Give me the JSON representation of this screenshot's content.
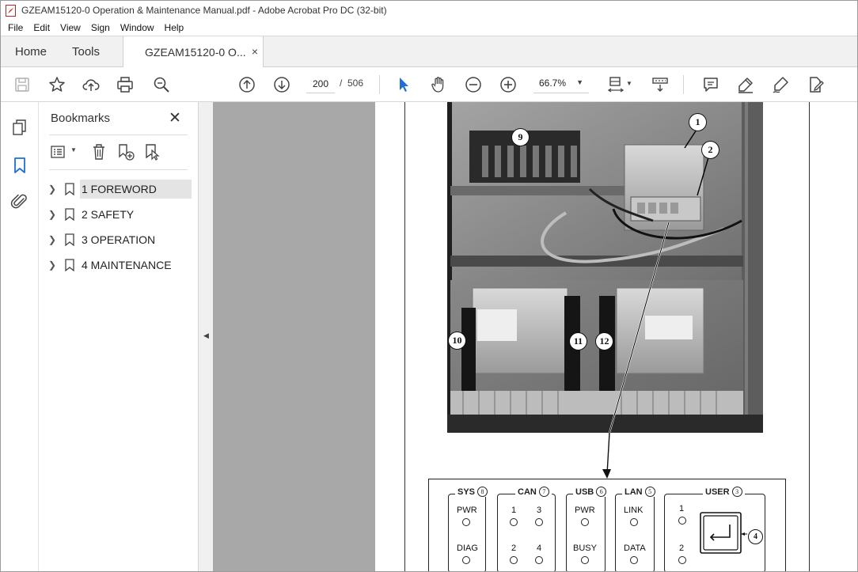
{
  "window": {
    "title": "GZEAM15120-0 Operation & Maintenance Manual.pdf - Adobe Acrobat Pro DC (32-bit)"
  },
  "menu": [
    "File",
    "Edit",
    "View",
    "Sign",
    "Window",
    "Help"
  ],
  "tabs": {
    "home": "Home",
    "tools": "Tools",
    "document": "GZEAM15120-0 O...",
    "close": "×"
  },
  "toolbar": {
    "page_current": "200",
    "page_separator": "/",
    "page_total": "506",
    "zoom": "66.7%"
  },
  "bookmarks": {
    "title": "Bookmarks",
    "close": "✕",
    "items": [
      {
        "label": "1 FOREWORD",
        "selected": true
      },
      {
        "label": "2 SAFETY"
      },
      {
        "label": "3 OPERATION"
      },
      {
        "label": "4 MAINTENANCE"
      }
    ]
  },
  "page": {
    "callouts": [
      "1",
      "2",
      "9",
      "10",
      "11",
      "12"
    ],
    "panel": {
      "groups": {
        "sys": {
          "title": "SYS",
          "num": "8",
          "leds": [
            "PWR",
            "DIAG"
          ]
        },
        "can": {
          "title": "CAN",
          "num": "7",
          "leds": [
            "1",
            "3",
            "2",
            "4"
          ]
        },
        "usb": {
          "title": "USB",
          "num": "6",
          "leds": [
            "PWR",
            "BUSY"
          ]
        },
        "lan": {
          "title": "LAN",
          "num": "5",
          "leds": [
            "LINK",
            "DATA"
          ]
        },
        "user": {
          "title": "USER",
          "num": "3",
          "leds": [
            "1",
            "2"
          ],
          "enter_callout": "4"
        }
      }
    }
  }
}
